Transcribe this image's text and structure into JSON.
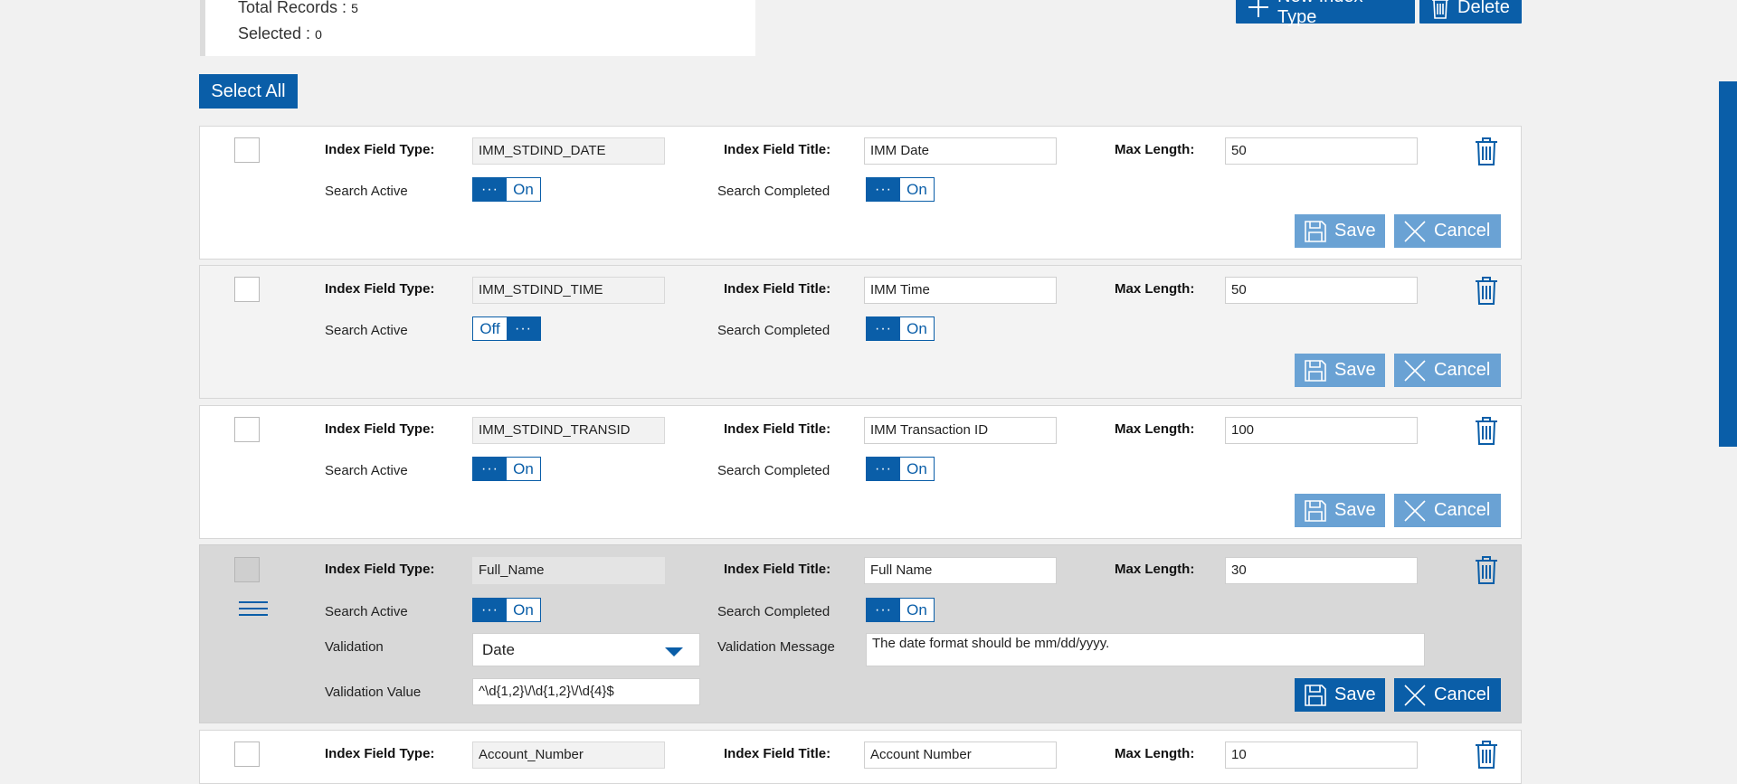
{
  "summary": {
    "total_label": "Total Records :",
    "total_value": "5",
    "selected_label": "Selected :",
    "selected_value": "0"
  },
  "toolbar": {
    "new_index_type": "New Index Type",
    "delete": "Delete",
    "select_all": "Select All"
  },
  "labels": {
    "index_field_type": "Index Field Type:",
    "index_field_title": "Index Field Title:",
    "max_length": "Max Length:",
    "search_active": "Search Active",
    "search_completed": "Search Completed",
    "validation": "Validation",
    "validation_message": "Validation Message",
    "validation_value": "Validation Value",
    "save": "Save",
    "cancel": "Cancel"
  },
  "records": [
    {
      "field_type": "IMM_STDIND_DATE",
      "field_title": "IMM Date",
      "max_length": "50",
      "search_active": "On",
      "search_completed": "On"
    },
    {
      "field_type": "IMM_STDIND_TIME",
      "field_title": "IMM Time",
      "max_length": "50",
      "search_active": "Off",
      "search_completed": "On"
    },
    {
      "field_type": "IMM_STDIND_TRANSID",
      "field_title": "IMM Transaction ID",
      "max_length": "100",
      "search_active": "On",
      "search_completed": "On"
    },
    {
      "field_type": "Full_Name",
      "field_title": "Full Name",
      "max_length": "30",
      "search_active": "On",
      "search_completed": "On",
      "validation": "Date",
      "validation_message": "The date format should be mm/dd/yyyy.",
      "validation_value": "^\\d{1,2}\\/\\d{1,2}\\/\\d{4}$"
    },
    {
      "field_type": "Account_Number",
      "field_title": "Account Number",
      "max_length": "10"
    }
  ],
  "toggle_dots": "···",
  "colors": {
    "primary": "#0a5ea8",
    "button_inactive": "#6aa2d4",
    "page_bg": "#f1f1f1"
  }
}
